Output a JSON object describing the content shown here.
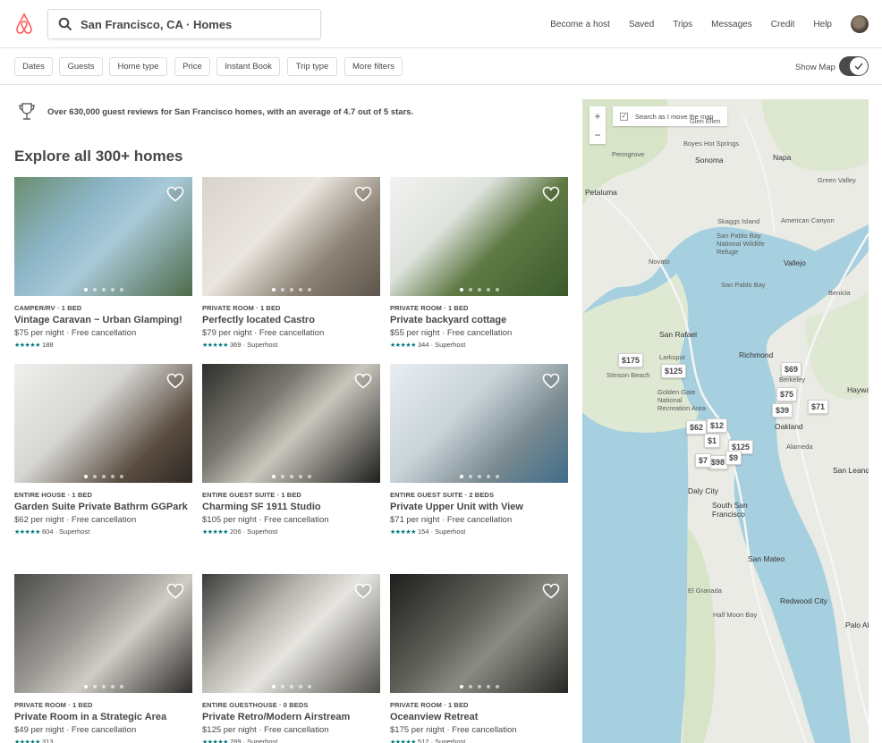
{
  "header": {
    "search_text": "San Francisco, CA · Homes",
    "nav": [
      "Become a host",
      "Saved",
      "Trips",
      "Messages",
      "Credit",
      "Help"
    ]
  },
  "filters": {
    "buttons": [
      "Dates",
      "Guests",
      "Home type",
      "Price",
      "Instant Book",
      "Trip type",
      "More filters"
    ],
    "show_map_label": "Show Map",
    "show_map_on": true
  },
  "banner": {
    "text": "Over 630,000 guest reviews for San Francisco homes, with an average of 4.7 out of 5 stars."
  },
  "section_title": "Explore all 300+ homes",
  "listings": [
    {
      "type": "CAMPER/RV · 1 BED",
      "title": "Vintage Caravan ~ Urban Glamping!",
      "price": "$75  per night · Free cancellation",
      "reviews": "188",
      "superhost": false
    },
    {
      "type": "PRIVATE ROOM · 1 BED",
      "title": "Perfectly located Castro",
      "price": "$79  per night · Free cancellation",
      "reviews": "369 · Superhost",
      "superhost": true
    },
    {
      "type": "PRIVATE ROOM · 1 BED",
      "title": "Private backyard cottage",
      "price": "$55  per night · Free cancellation",
      "reviews": "344 · Superhost",
      "superhost": true
    },
    {
      "type": "ENTIRE HOUSE · 1 BED",
      "title": "Garden Suite Private Bathrm GGPark",
      "price": "$62  per night · Free cancellation",
      "reviews": "604 · Superhost",
      "superhost": true
    },
    {
      "type": "ENTIRE GUEST SUITE · 1 BED",
      "title": "Charming SF 1911 Studio",
      "price": "$105  per night · Free cancellation",
      "reviews": "206 · Superhost",
      "superhost": true
    },
    {
      "type": "ENTIRE GUEST SUITE · 2 BEDS",
      "title": "Private Upper Unit with View",
      "price": "$71  per night · Free cancellation",
      "reviews": "154 · Superhost",
      "superhost": true
    },
    {
      "type": "PRIVATE ROOM · 1 BED",
      "title": "Private Room in a Strategic Area",
      "price": "$49  per night · Free cancellation",
      "reviews": "313",
      "superhost": false
    },
    {
      "type": "ENTIRE GUESTHOUSE · 0 BEDS",
      "title": "Private Retro/Modern Airstream",
      "price": "$125  per night · Free cancellation",
      "reviews": "789 · Superhost",
      "superhost": true
    },
    {
      "type": "PRIVATE ROOM · 1 BED",
      "title": "Oceanview Retreat",
      "price": "$175  per night · Free cancellation",
      "reviews": "512 · Superhost",
      "superhost": true
    }
  ],
  "map": {
    "zoom_in": "+",
    "zoom_out": "−",
    "search_as_move": "Search as I move the map",
    "search_as_move_checked": true,
    "pins": [
      "$175",
      "$125",
      "$69",
      "$75",
      "$39",
      "$71",
      "$62",
      "$12",
      "$1",
      "$125",
      "$98",
      "$7",
      "$9"
    ],
    "places": [
      "Petaluma",
      "Sonoma",
      "Napa",
      "Boyes Hot Springs",
      "Penngrove",
      "Glen Ellen",
      "Green Valley",
      "Skaggs Island",
      "American Canyon",
      "San Pablo Bay National Wildlife Refuge",
      "Novato",
      "Vallejo",
      "San Pablo Bay",
      "Benicia",
      "San Rafael",
      "Larkspur",
      "Richmond",
      "Stinson Beach",
      "Golden Gate National Recreation Area",
      "Oakland",
      "Alameda",
      "Daly City",
      "San Leandro",
      "South San Francisco",
      "San Mateo",
      "El Granada",
      "Redwood City",
      "Palo Alto",
      "Half Moon Bay",
      "Hayward",
      "Berkeley"
    ]
  }
}
